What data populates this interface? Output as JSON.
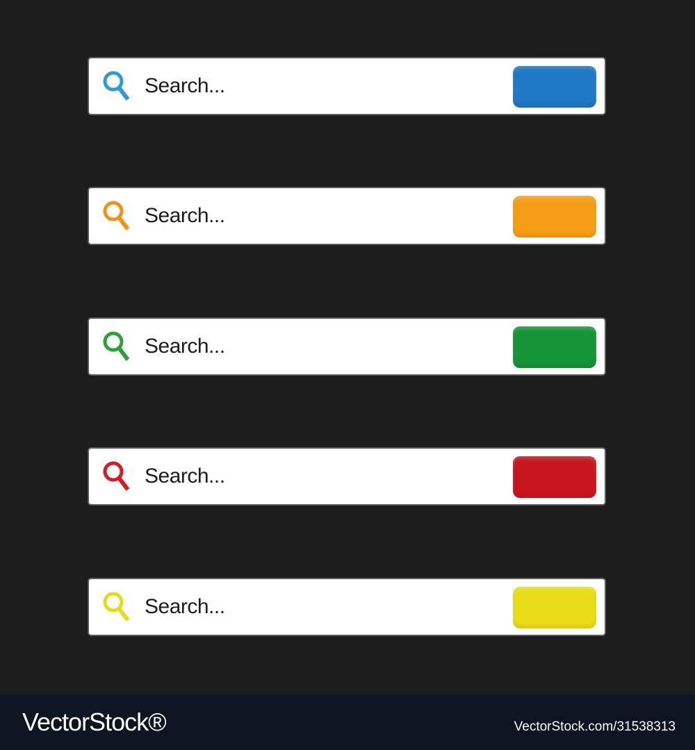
{
  "search_bars": [
    {
      "placeholder": "Search...",
      "accent_color": "#2f9ad9",
      "button_color": "#1f78c3"
    },
    {
      "placeholder": "Search...",
      "accent_color": "#f19216",
      "button_color": "#f59d16"
    },
    {
      "placeholder": "Search...",
      "accent_color": "#2f9f3a",
      "button_color": "#169337"
    },
    {
      "placeholder": "Search...",
      "accent_color": "#d51b24",
      "button_color": "#c7161d"
    },
    {
      "placeholder": "Search...",
      "accent_color": "#e6db18",
      "button_color": "#e9dc17"
    }
  ],
  "footer": {
    "logo": "VectorStock®",
    "image_id": "VectorStock.com/31538313"
  }
}
